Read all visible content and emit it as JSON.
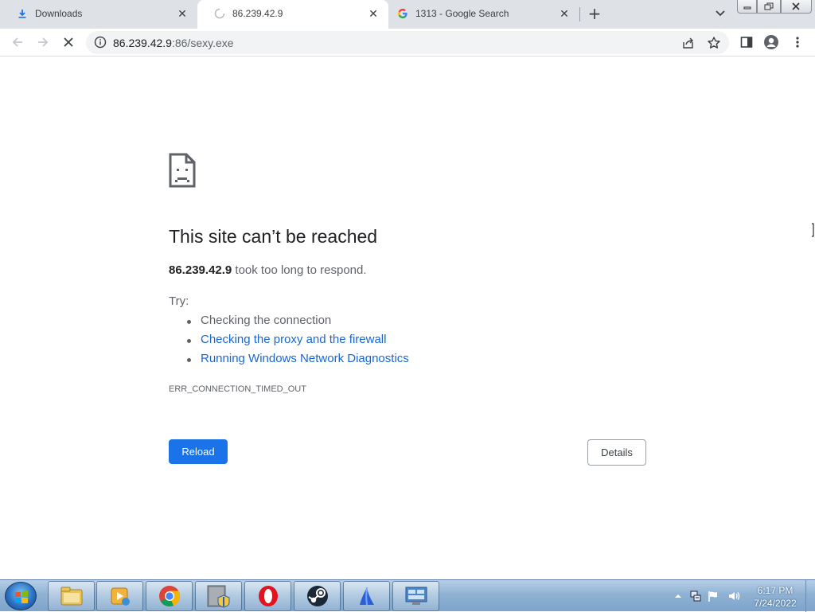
{
  "browser": {
    "tabs": [
      {
        "title": "Downloads",
        "icon": "download-icon",
        "active": false
      },
      {
        "title": "86.239.42.9",
        "icon": "loading-spinner-icon",
        "active": true
      },
      {
        "title": "1313 - Google Search",
        "icon": "google-icon",
        "active": false
      }
    ],
    "close_glyph": "✕",
    "new_tab_glyph": "+",
    "url_host": "86.239.42.9",
    "url_rest": ":86/sexy.exe"
  },
  "error_page": {
    "heading": "This site can’t be reached",
    "summary_host": "86.239.42.9",
    "summary_text": " took too long to respond.",
    "try_label": "Try:",
    "suggestions": [
      {
        "text": "Checking the connection",
        "link": false
      },
      {
        "text": "Checking the proxy and the firewall",
        "link": true
      },
      {
        "text": "Running Windows Network Diagnostics",
        "link": true
      }
    ],
    "error_code": "ERR_CONNECTION_TIMED_OUT",
    "reload_label": "Reload",
    "details_label": "Details"
  },
  "taskbar": {
    "pinned": [
      "file-explorer-icon",
      "media-player-icon",
      "chrome-icon",
      "installer-icon",
      "opera-icon",
      "steam-icon",
      "sail-app-icon",
      "control-panel-icon"
    ],
    "time": "6:17 PM",
    "date": "7/24/2022"
  },
  "colors": {
    "accent": "#1a73e8",
    "link": "#1967d2",
    "tabstrip": "#dee1e6"
  }
}
